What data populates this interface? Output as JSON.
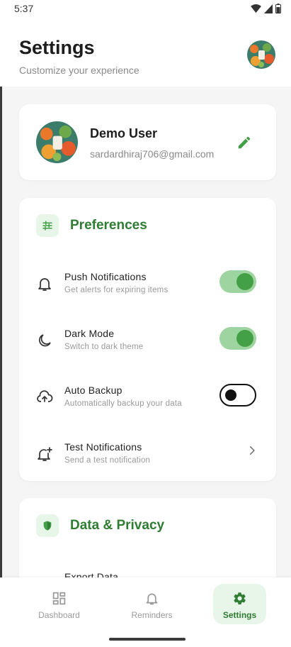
{
  "status_bar": {
    "time": "5:37"
  },
  "header": {
    "title": "Settings",
    "subtitle": "Customize your experience",
    "avatar_icon": "profile-avatar"
  },
  "profile": {
    "name": "Demo User",
    "email": "sardardhiraj706@gmail.com",
    "edit_icon": "pencil-icon"
  },
  "preferences": {
    "title": "Preferences",
    "icon": "sliders-icon",
    "items": [
      {
        "label": "Push Notifications",
        "description": "Get alerts for expiring items",
        "icon": "bell-icon",
        "control": "toggle",
        "on": true
      },
      {
        "label": "Dark Mode",
        "description": "Switch to dark theme",
        "icon": "moon-icon",
        "control": "toggle",
        "on": true
      },
      {
        "label": "Auto Backup",
        "description": "Automatically backup your data",
        "icon": "cloud-upload-icon",
        "control": "toggle",
        "on": false
      },
      {
        "label": "Test Notifications",
        "description": "Send a test notification",
        "icon": "bell-plus-icon",
        "control": "chevron"
      }
    ]
  },
  "data_privacy": {
    "title": "Data & Privacy",
    "icon": "shield-icon",
    "items": [
      {
        "label": "Export Data"
      }
    ]
  },
  "bottom_nav": {
    "items": [
      {
        "label": "Dashboard",
        "icon": "grid-icon",
        "active": false
      },
      {
        "label": "Reminders",
        "icon": "bell-icon",
        "active": false
      },
      {
        "label": "Settings",
        "icon": "gear-icon",
        "active": true
      }
    ]
  },
  "colors": {
    "accent": "#2e7d32",
    "toggle_on_track": "#9ed49f",
    "toggle_on_knob": "#43a047",
    "accent_bg": "#e8f5e9"
  }
}
